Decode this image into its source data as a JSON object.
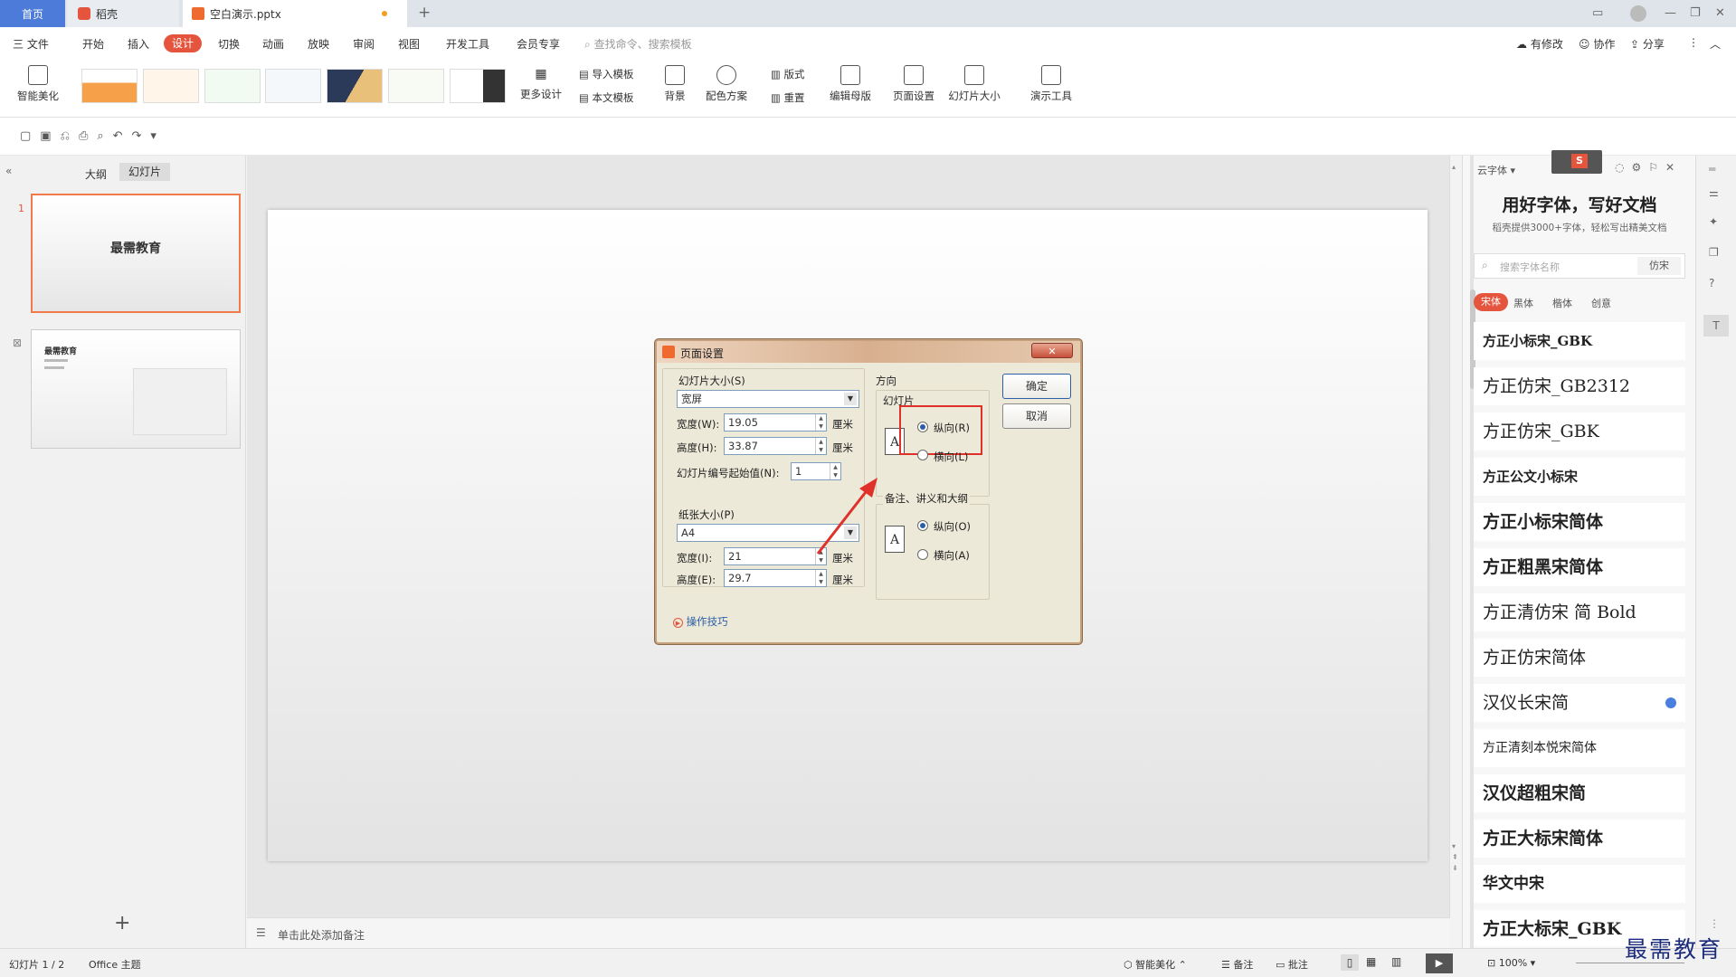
{
  "titlebar": {
    "home_tab": "首页",
    "tab2": "稻壳",
    "tab3": "空白演示.pptx",
    "new_tab": "+"
  },
  "menu": {
    "file": "三 文件",
    "items": [
      "开始",
      "插入",
      "设计",
      "切换",
      "动画",
      "放映",
      "审阅",
      "视图",
      "开发工具",
      "会员专享"
    ],
    "active": "设计",
    "search_placeholder": "查找命令、搜索模板",
    "right": [
      "有修改",
      "协作",
      "分享"
    ]
  },
  "ribbon": {
    "smart": "智能美化",
    "more_design": "更多设计",
    "import_template": "导入模板",
    "text_template": "本文模板",
    "background": "背景",
    "color_scheme": "配色方案",
    "layout": "版式",
    "reset": "重置",
    "edit_master": "编辑母版",
    "page_setup": "页面设置",
    "slide_size": "幻灯片大小",
    "presenter_tools": "演示工具"
  },
  "leftpane": {
    "outline_tab": "大纲",
    "slides_tab": "幻灯片",
    "slide1_num": "1",
    "slide1_title": "最需教育",
    "slide2_title": "最需教育",
    "add": "+"
  },
  "notes": {
    "placeholder": "单击此处添加备注"
  },
  "dialog": {
    "title": "页面设置",
    "slide_size_label": "幻灯片大小(S)",
    "slide_size_value": "宽屏",
    "width_label": "宽度(W):",
    "width_value": "19.05",
    "unit": "厘米",
    "height_label": "高度(H):",
    "height_value": "33.87",
    "start_label": "幻灯片编号起始值(N):",
    "start_value": "1",
    "paper_label": "纸张大小(P)",
    "paper_value": "A4",
    "pwidth_label": "宽度(I):",
    "pwidth_value": "21",
    "pheight_label": "高度(E):",
    "pheight_value": "29.7",
    "tips": "操作技巧",
    "orientation": "方向",
    "slides_group": "幻灯片",
    "portrait": "纵向(R)",
    "landscape": "横向(L)",
    "notes_group": "备注、讲义和大纲",
    "notes_portrait": "纵向(O)",
    "notes_landscape": "横向(A)",
    "ok": "确定",
    "cancel": "取消"
  },
  "rightpanel": {
    "header": "云字体",
    "title": "用好字体，写好文档",
    "subtitle": "稻壳提供3000+字体，轻松写出精美文档",
    "search_placeholder": "搜索字体名称",
    "search_tag": "仿宋",
    "categories": [
      "宋体",
      "黑体",
      "楷体",
      "创意"
    ],
    "fonts": [
      "方正小标宋_GBK",
      "方正仿宋_GB2312",
      "方正仿宋_GBK",
      "方正公文小标宋",
      "方正小标宋简体",
      "方正粗黑宋简体",
      "方正清仿宋 简 Bold",
      "方正仿宋简体",
      "汉仪长宋简",
      "方正清刻本悦宋简体",
      "汉仪超粗宋简",
      "方正大标宋简体",
      "华文中宋",
      "方正大标宋_GBK"
    ]
  },
  "status": {
    "slide_count": "幻灯片 1 / 2",
    "theme": "Office 主题",
    "smart": "智能美化",
    "notes": "备注",
    "comments": "批注",
    "zoom": "100%"
  },
  "watermark": "最需教育"
}
